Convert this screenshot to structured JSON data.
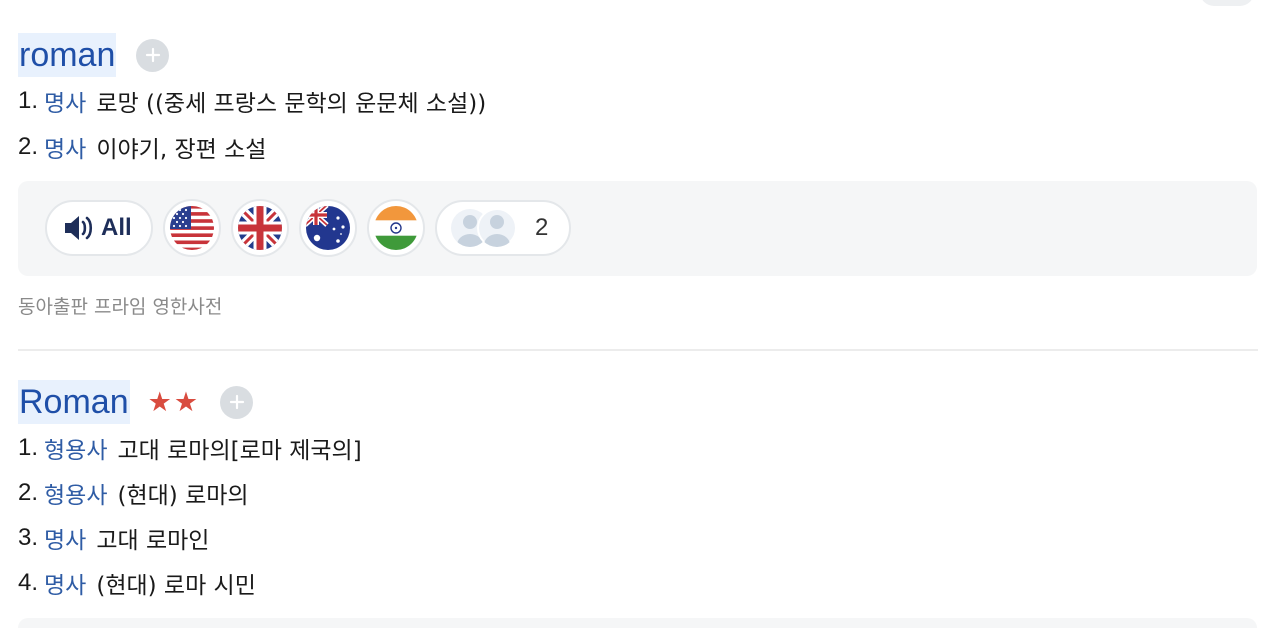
{
  "entries": [
    {
      "headword": "roman",
      "stars": "",
      "senses": [
        {
          "num": "1.",
          "pos": "명사",
          "meaning": "로망 ((중세 프랑스 문학의 운문체 소설))"
        },
        {
          "num": "2.",
          "pos": "명사",
          "meaning": "이야기, 장편 소설"
        }
      ],
      "audio": {
        "all_label": "All",
        "flags": [
          "us-flag-icon",
          "uk-flag-icon",
          "australia-flag-icon",
          "india-flag-icon"
        ],
        "user_count": "2"
      },
      "source": "동아출판 프라임 영한사전"
    },
    {
      "headword": "Roman",
      "stars": "★★",
      "senses": [
        {
          "num": "1.",
          "pos": "형용사",
          "meaning": "고대 로마의[로마 제국의]"
        },
        {
          "num": "2.",
          "pos": "형용사",
          "meaning": "(현대) 로마의"
        },
        {
          "num": "3.",
          "pos": "명사",
          "meaning": "고대 로마인"
        },
        {
          "num": "4.",
          "pos": "명사",
          "meaning": "(현대) 로마 시민"
        }
      ]
    }
  ],
  "colors": {
    "headword": "#1f4fa8",
    "headword_bg": "#e8f1fd",
    "pos": "#2f5ca5",
    "stars": "#d94c3f",
    "panel_bg": "#f5f6f7"
  }
}
